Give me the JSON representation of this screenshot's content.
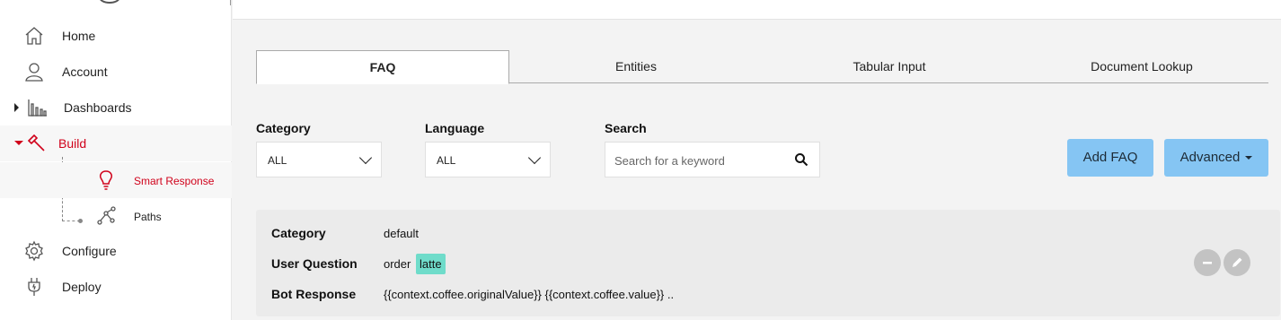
{
  "sidebar": {
    "items": [
      {
        "label": "Home",
        "icon": "home-icon"
      },
      {
        "label": "Account",
        "icon": "user-icon"
      },
      {
        "label": "Dashboards",
        "icon": "bar-chart-icon"
      },
      {
        "label": "Build",
        "icon": "hammer-icon"
      },
      {
        "label": "Configure",
        "icon": "gear-icon"
      },
      {
        "label": "Deploy",
        "icon": "plug-icon"
      }
    ],
    "build_children": [
      {
        "label": "Smart Response",
        "icon": "lightbulb-icon"
      },
      {
        "label": "Paths",
        "icon": "path-icon"
      }
    ],
    "active_color": "#d0021b"
  },
  "tabs": [
    "FAQ",
    "Entities",
    "Tabular Input",
    "Document Lookup"
  ],
  "filters": {
    "category_label": "Category",
    "category_value": "ALL",
    "language_label": "Language",
    "language_value": "ALL",
    "search_label": "Search",
    "search_placeholder": "Search for a keyword"
  },
  "actions": {
    "add_faq": "Add FAQ",
    "advanced": "Advanced"
  },
  "faq_card": {
    "category_key": "Category",
    "category_value": "default",
    "question_key": "User Question",
    "question_text": "order",
    "question_entity": "latte",
    "response_key": "Bot Response",
    "response_value": "{{context.coffee.originalValue}} {{context.coffee.value}} .."
  },
  "colors": {
    "button_bg": "#85c5f3",
    "entity_highlight": "#6fdcca"
  }
}
